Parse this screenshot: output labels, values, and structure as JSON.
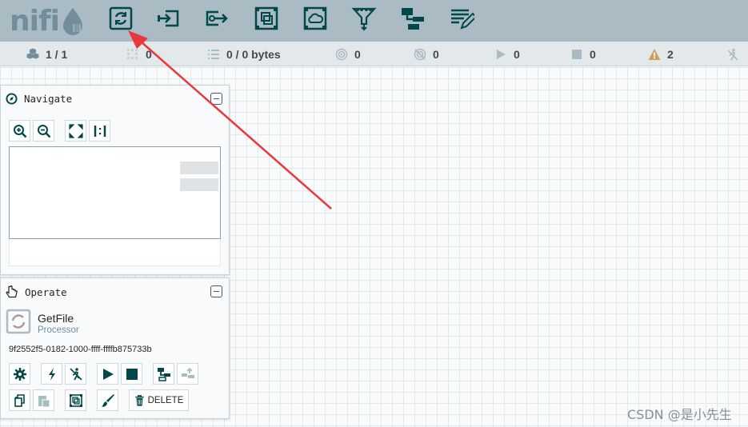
{
  "app": {
    "logo_text": "nifi"
  },
  "toolbar": {
    "items": [
      {
        "name": "processor-tool",
        "icon": "processor-icon"
      },
      {
        "name": "input-port-tool",
        "icon": "input-port-icon"
      },
      {
        "name": "output-port-tool",
        "icon": "output-port-icon"
      },
      {
        "name": "process-group-tool",
        "icon": "process-group-icon"
      },
      {
        "name": "remote-process-group-tool",
        "icon": "remote-process-group-icon"
      },
      {
        "name": "funnel-tool",
        "icon": "funnel-icon"
      },
      {
        "name": "template-tool",
        "icon": "template-icon"
      },
      {
        "name": "label-tool",
        "icon": "label-icon"
      }
    ]
  },
  "status": {
    "components": "1 / 1",
    "transmitting": "0",
    "queued": "0 / 0 bytes",
    "remote_transmitting": "0",
    "remote_not_transmitting": "0",
    "running": "0",
    "stopped": "0",
    "invalid": "2",
    "disabled": ""
  },
  "navigate": {
    "title": "Navigate"
  },
  "operate": {
    "title": "Operate",
    "selection_name": "GetFile",
    "selection_type": "Processor",
    "selection_id": "9f2552f5-0182-1000-ffff-ffffb875733b",
    "delete_label": "DELETE"
  },
  "watermark": "CSDN @是小先生",
  "colors": {
    "header_bg": "#aabbc3",
    "icon_dark": "#004849",
    "status_bg": "#e3e8eb",
    "warning": "#cf9f5d",
    "arrow": "#e8383d"
  }
}
